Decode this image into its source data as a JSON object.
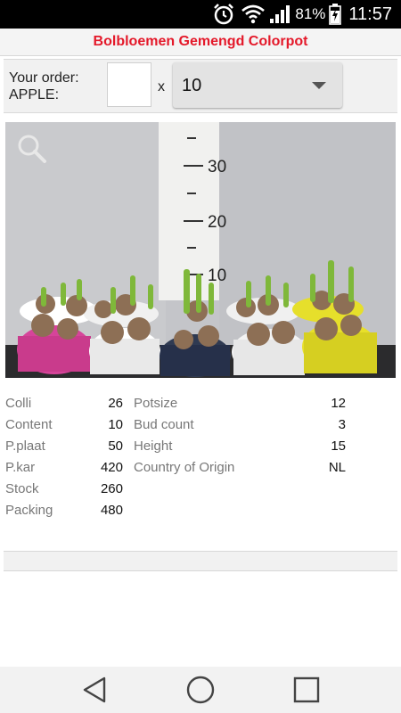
{
  "status_bar": {
    "battery_percent": "81%",
    "time": "11:57"
  },
  "header": {
    "title": "Bolbloemen Gemengd Colorpot"
  },
  "order": {
    "label_line1": "Your order:",
    "label_line2": "APPLE:",
    "quantity_value": "",
    "multiplier": "x",
    "selected_option": "10"
  },
  "photo": {
    "ruler_marks": [
      "30",
      "20",
      "10"
    ]
  },
  "specs_left": [
    {
      "label": "Colli",
      "value": "26"
    },
    {
      "label": "Content",
      "value": "10"
    },
    {
      "label": "P.plaat",
      "value": "50"
    },
    {
      "label": "P.kar",
      "value": "420"
    },
    {
      "label": "Stock",
      "value": "260"
    },
    {
      "label": "Packing",
      "value": "480"
    }
  ],
  "specs_right": [
    {
      "label": "Potsize",
      "value": "12"
    },
    {
      "label": "Bud count",
      "value": "3"
    },
    {
      "label": "Height",
      "value": "15"
    },
    {
      "label": "Country of Origin",
      "value": "NL"
    }
  ]
}
